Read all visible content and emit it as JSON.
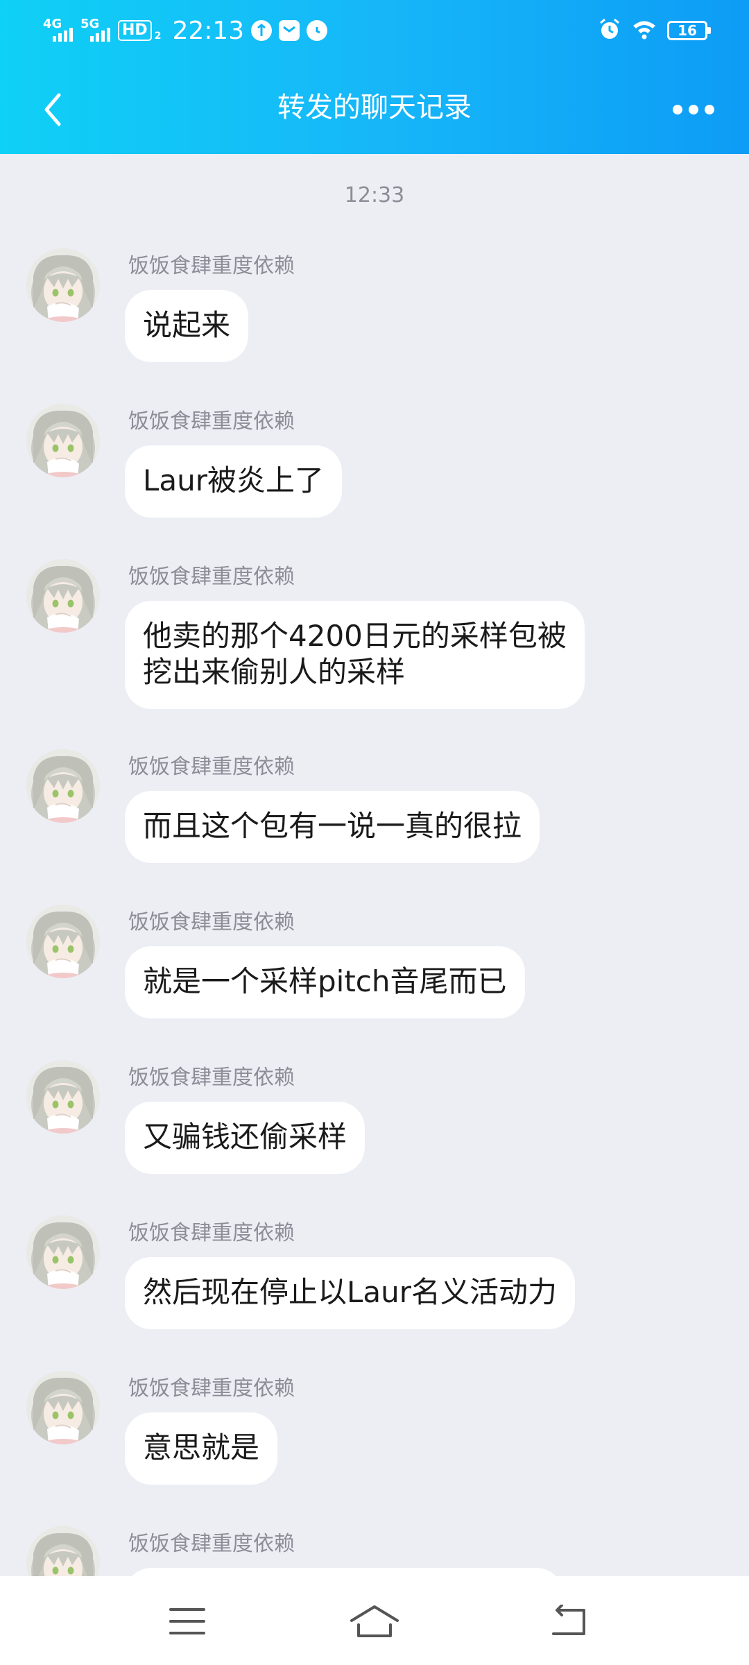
{
  "status_bar": {
    "signal_1": "4G",
    "signal_2": "5G",
    "hd": "HD",
    "hd_sub": "2",
    "time": "22:13",
    "left_icons": [
      "data-saver-icon",
      "mail-icon",
      "alarm-icon"
    ],
    "right_icons": [
      "alarm-icon",
      "wifi-icon"
    ],
    "battery": "16"
  },
  "header": {
    "title": "转发的聊天记录",
    "back_icon": "chevron-left-icon",
    "more_icon": "more-dots-icon"
  },
  "chat": {
    "timestamp": "12:33",
    "messages": [
      {
        "sender": "饭饭食肆重度依赖",
        "text": "说起来"
      },
      {
        "sender": "饭饭食肆重度依赖",
        "text": "Laur被炎上了"
      },
      {
        "sender": "饭饭食肆重度依赖",
        "lines": [
          "他卖的那个4200日元的采样包被",
          "挖出来偷别人的采样"
        ]
      },
      {
        "sender": "饭饭食肆重度依赖",
        "text": "而且这个包有一说一真的很拉"
      },
      {
        "sender": "饭饭食肆重度依赖",
        "text": "就是一个采样pitch音尾而已"
      },
      {
        "sender": "饭饭食肆重度依赖",
        "text": "又骗钱还偷采样"
      },
      {
        "sender": "饭饭食肆重度依赖",
        "text": "然后现在停止以Laur名义活动力"
      },
      {
        "sender": "饭饭食肆重度依赖",
        "text": "意思就是"
      },
      {
        "sender": "饭饭食肆重度依赖",
        "text": ""
      }
    ]
  },
  "bottom_nav": {
    "icons": [
      "menu-icon",
      "home-icon",
      "back-icon"
    ]
  },
  "colors": {
    "header_start": "#0fd0f6",
    "header_end": "#0d9cf6",
    "chat_background": "#eceef4",
    "bubble": "#ffffff",
    "nickname": "#8b8e96"
  }
}
